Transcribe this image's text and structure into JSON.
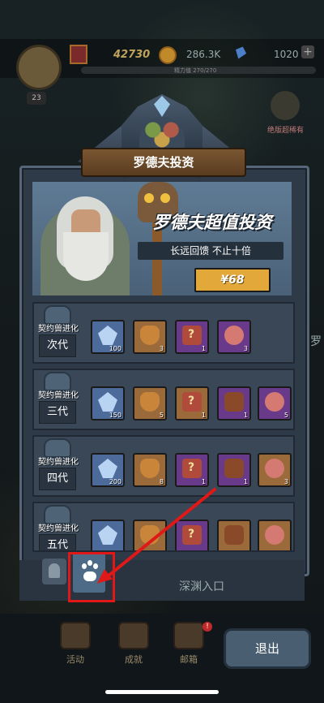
{
  "hud": {
    "level": "23",
    "power": "42730",
    "gold": "286.3K",
    "gems": "1020",
    "exp": "精力值 270/270",
    "side_label": "绝版超稀有",
    "right_edge_text": "罗"
  },
  "panel": {
    "title": "罗德夫投资",
    "hero_title": "罗德夫超值投资",
    "hero_subtitle": "长远回馈 不止十倍",
    "price": "¥68"
  },
  "tiers": [
    {
      "label": "契约兽进化",
      "gen": "次代",
      "items": [
        {
          "icon": "crystal-icon",
          "color": "blue",
          "count": "100"
        },
        {
          "icon": "jar-icon",
          "color": "brown",
          "count": "3"
        },
        {
          "icon": "chest-icon",
          "color": "purple",
          "count": "1"
        },
        {
          "icon": "meat-icon",
          "color": "purple",
          "count": "3"
        }
      ]
    },
    {
      "label": "契约兽进化",
      "gen": "三代",
      "items": [
        {
          "icon": "crystal-icon",
          "color": "blue",
          "count": "150"
        },
        {
          "icon": "jar-icon",
          "color": "brown",
          "count": "5"
        },
        {
          "icon": "chest-icon",
          "color": "brown",
          "count": "1"
        },
        {
          "icon": "beast-icon",
          "color": "purple",
          "count": "1"
        },
        {
          "icon": "meat-icon",
          "color": "purple",
          "count": "5"
        }
      ]
    },
    {
      "label": "契约兽进化",
      "gen": "四代",
      "items": [
        {
          "icon": "crystal-icon",
          "color": "blue",
          "count": "200"
        },
        {
          "icon": "jar-icon",
          "color": "brown",
          "count": "8"
        },
        {
          "icon": "chest-icon",
          "color": "purple",
          "count": "1"
        },
        {
          "icon": "beast-icon",
          "color": "purple",
          "count": "1"
        },
        {
          "icon": "meat-icon",
          "color": "brown",
          "count": "3"
        }
      ]
    },
    {
      "label": "契约兽进化",
      "gen": "五代",
      "items": [
        {
          "icon": "crystal-icon",
          "color": "blue",
          "count": ""
        },
        {
          "icon": "jar-icon",
          "color": "brown",
          "count": ""
        },
        {
          "icon": "chest-icon",
          "color": "purple",
          "count": ""
        },
        {
          "icon": "beast-icon",
          "color": "brown",
          "count": ""
        },
        {
          "icon": "meat-icon",
          "color": "brown",
          "count": ""
        }
      ]
    }
  ],
  "tabs": {
    "abyss": "深渊入口"
  },
  "nav": {
    "activity": "活动",
    "achievement": "成就",
    "mail": "邮箱",
    "mail_badge": "!",
    "exit": "退出"
  }
}
